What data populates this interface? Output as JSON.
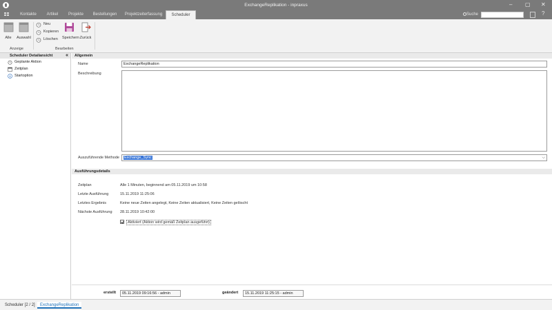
{
  "window": {
    "title": "ExchangeReplikation - inpraxus",
    "minimize": "–",
    "maximize": "▢",
    "close": "✕"
  },
  "tabs": [
    {
      "label": "Kontakte",
      "active": false
    },
    {
      "label": "Artikel",
      "active": false
    },
    {
      "label": "Projekte",
      "active": false
    },
    {
      "label": "Bestellungen",
      "active": false
    },
    {
      "label": "Projektzeiterfassung",
      "active": false
    },
    {
      "label": "Scheduler",
      "active": true
    }
  ],
  "search": {
    "label": "Suche",
    "placeholder": ""
  },
  "help_glyph": "?",
  "ribbon": {
    "alle": "Alle",
    "auswahl": "Auswahl",
    "neu": "Neu",
    "kopieren": "Kopieren",
    "loeschen": "Löschen",
    "speichern": "Speichern",
    "zurueck": "Zurück",
    "group_anzeige": "Anzeige",
    "group_bearbeiten": "Bearbeiten"
  },
  "sidebar": {
    "title": "Scheduler Detailansicht",
    "collapse": "«",
    "items": [
      {
        "label": "Geplante Aktion",
        "icon": "alarm-clock-icon"
      },
      {
        "label": "Zeitplan",
        "icon": "calendar-icon"
      },
      {
        "label": "Startoption",
        "icon": "info-icon"
      }
    ]
  },
  "allgemein": {
    "header": "Allgemein",
    "name_label": "Name",
    "name_value": "ExchangeReplikation",
    "beschreibung_label": "Beschreibung",
    "beschreibung_value": "",
    "methode_label": "Auszuführende Methode",
    "methode_value": "Exchange_Sync"
  },
  "details": {
    "header": "Ausführungsdetails",
    "rows": [
      {
        "label": "Zeitplan",
        "value": "Alle 1 Minuten, beginnend am 05.11.2019 um 10:58"
      },
      {
        "label": "Letzte Ausführung",
        "value": "15.11.2019 11:25:06"
      },
      {
        "label": "Letztes Ergebnis",
        "value": "Keine neue Zeiten angelegt, Keine Zeiten aktualisiert, Keine Zeiten gelöscht"
      },
      {
        "label": "Nächste Ausführung",
        "value": "28.11.2019 10:42:00"
      }
    ],
    "aktiviert_label": "Aktiviert (Aktion wird gemäß Zeitplan ausgeführt)",
    "aktiviert_checked": true
  },
  "footer": {
    "erstellt_label": "erstellt",
    "erstellt_value": "05.11.2019 09:16:56 - admin",
    "geaendert_label": "geändert",
    "geaendert_value": "15.11.2019 11:25:15 - admin"
  },
  "bottom_tabs": [
    {
      "label": "Scheduler [2 / 2]",
      "active": false
    },
    {
      "label": "ExchangeReplikation",
      "active": true
    }
  ],
  "colors": {
    "titlebar": "#7a7a7a",
    "accent": "#1e70b8",
    "selection": "#3875d7"
  }
}
